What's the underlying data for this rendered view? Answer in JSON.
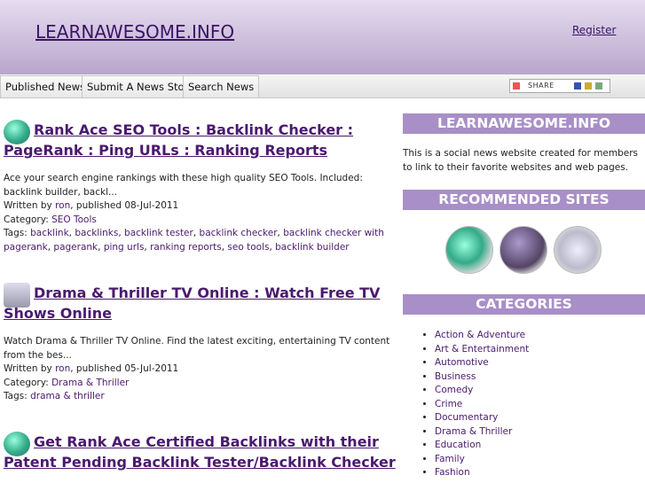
{
  "header": {
    "site_title": "LEARNAWESOME.INFO",
    "register": "Register"
  },
  "nav": [
    "Published News",
    "Submit A News Story",
    "Search News"
  ],
  "share": {
    "label": "SHARE"
  },
  "stories": [
    {
      "headline": "Rank Ace SEO Tools : Backlink Checker : PageRank : Ping URLs : Ranking Reports",
      "excerpt": "Ace your search engine rankings with these high quality SEO Tools. Included: backlink builder, backl...",
      "written_by": "Written by ",
      "author": "ron",
      "published": ", published 08-Jul-2011",
      "category_label": "Category: ",
      "category": "SEO Tools",
      "tags_label": "Tags: ",
      "tags": [
        "backlink",
        "backlinks",
        "backlink tester",
        "backlink checker",
        "backlink checker with pagerank",
        "pagerank",
        "ping urls",
        "ranking reports",
        "seo tools",
        "backlink builder"
      ]
    },
    {
      "headline": "Drama & Thriller TV Online : Watch Free TV Shows Online",
      "excerpt": "Watch Drama & Thriller TV Online. Find the latest exciting, entertaining TV content from the bes...",
      "written_by": "Written by ",
      "author": "ron",
      "published": ", published 05-Jul-2011",
      "category_label": "Category: ",
      "category": "Drama & Thriller",
      "tags_label": "Tags: ",
      "tags": [
        "drama & thriller"
      ]
    },
    {
      "headline": "Get Rank Ace Certified Backlinks with their Patent Pending Backlink Tester/Backlink Checker"
    }
  ],
  "sidebar": {
    "site_heading": "LEARNAWESOME.INFO",
    "description": "This is a social news website created for members to link to their favorite websites and web pages.",
    "recommended_heading": "RECOMMENDED SITES",
    "categories_heading": "CATEGORIES",
    "categories": [
      "Action & Adventure",
      "Art & Entertainment",
      "Automotive",
      "Business",
      "Comedy",
      "Crime",
      "Documentary",
      "Drama & Thriller",
      "Education",
      "Family",
      "Fashion"
    ]
  },
  "colors": {
    "accent": "#a88fc7",
    "link": "#4a1a6e"
  }
}
